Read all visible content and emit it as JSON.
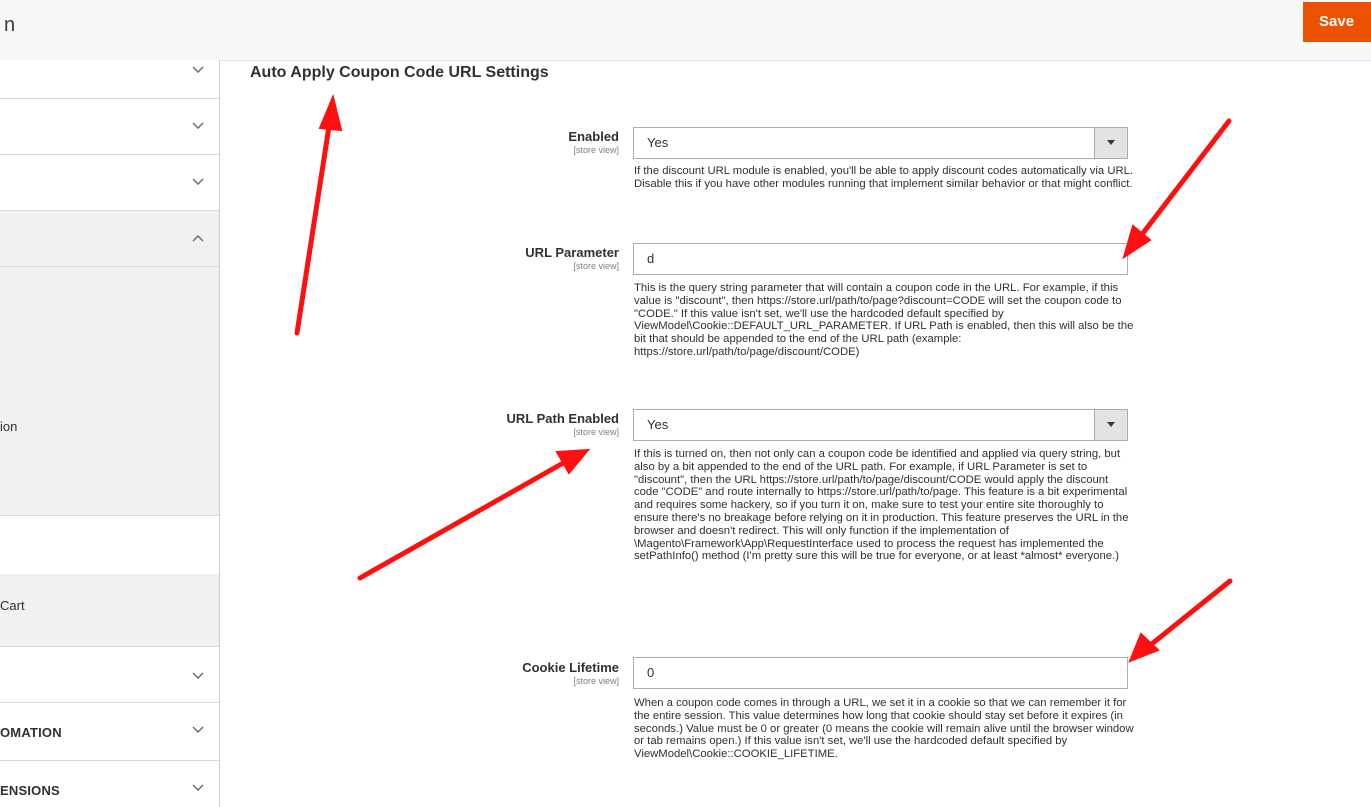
{
  "header": {
    "title_fragment": "n",
    "save_label": "Save"
  },
  "sidebar": {
    "items": [
      {
        "label": "",
        "chevron": "chevron-down"
      },
      {
        "label": "",
        "chevron": "chevron-down"
      },
      {
        "label": "",
        "chevron": "chevron-down"
      },
      {
        "label": "",
        "chevron": "chevron-up"
      },
      {
        "label": "ion"
      },
      {
        "label": "Cart"
      },
      {
        "label": "",
        "chevron": "chevron-down"
      },
      {
        "label": "OMATION",
        "chevron": "chevron-down"
      },
      {
        "label": "ENSIONS",
        "chevron": "chevron-down"
      }
    ]
  },
  "section": {
    "title": "Auto Apply Coupon Code URL Settings"
  },
  "fields": {
    "enabled": {
      "label": "Enabled",
      "scope": "[store view]",
      "value": "Yes",
      "note": "If the discount URL module is enabled, you'll be able to apply discount codes automatically via URL. Disable this if you have other modules running that implement similar behavior or that might conflict."
    },
    "url_parameter": {
      "label": "URL Parameter",
      "scope": "[store view]",
      "value": "d",
      "note": "This is the query string parameter that will contain a coupon code in the URL. For example, if this value is \"discount\", then https://store.url/path/to/page?discount=CODE will set the coupon code to \"CODE.\" If this value isn't set, we'll use the hardcoded default specified by ViewModel\\Cookie::DEFAULT_URL_PARAMETER. If URL Path is enabled, then this will also be the bit that should be appended to the end of the URL path (example: https://store.url/path/to/page/discount/CODE)"
    },
    "url_path_enabled": {
      "label": "URL Path Enabled",
      "scope": "[store view]",
      "value": "Yes",
      "note": "If this is turned on, then not only can a coupon code be identified and applied via query string, but also by a bit appended to the end of the URL path. For example, if URL Parameter is set to \"discount\", then the URL https://store.url/path/to/page/discount/CODE would apply the discount code \"CODE\" and route internally to https://store.url/path/to/page. This feature is a bit experimental and requires some hackery, so if you turn it on, make sure to test your entire site thoroughly to ensure there's no breakage before relying on it in production. This feature preserves the URL in the browser and doesn't redirect. This will only function if the implementation of \\Magento\\Framework\\App\\RequestInterface used to process the request has implemented the setPathInfo() method (I'm pretty sure this will be true for everyone, or at least *almost* everyone.)"
    },
    "cookie_lifetime": {
      "label": "Cookie Lifetime",
      "scope": "[store view]",
      "value": "0",
      "note": "When a coupon code comes in through a URL, we set it in a cookie so that we can remember it for the entire session. This value determines how long that cookie should stay set before it expires (in seconds.) Value must be 0 or greater (0 means the cookie will remain alive until the browser window or tab remains open.) If this value isn't set, we'll use the hardcoded default specified by ViewModel\\Cookie::COOKIE_LIFETIME."
    }
  },
  "colors": {
    "accent": "#eb5202",
    "annotation_arrow": "#ff1010"
  }
}
